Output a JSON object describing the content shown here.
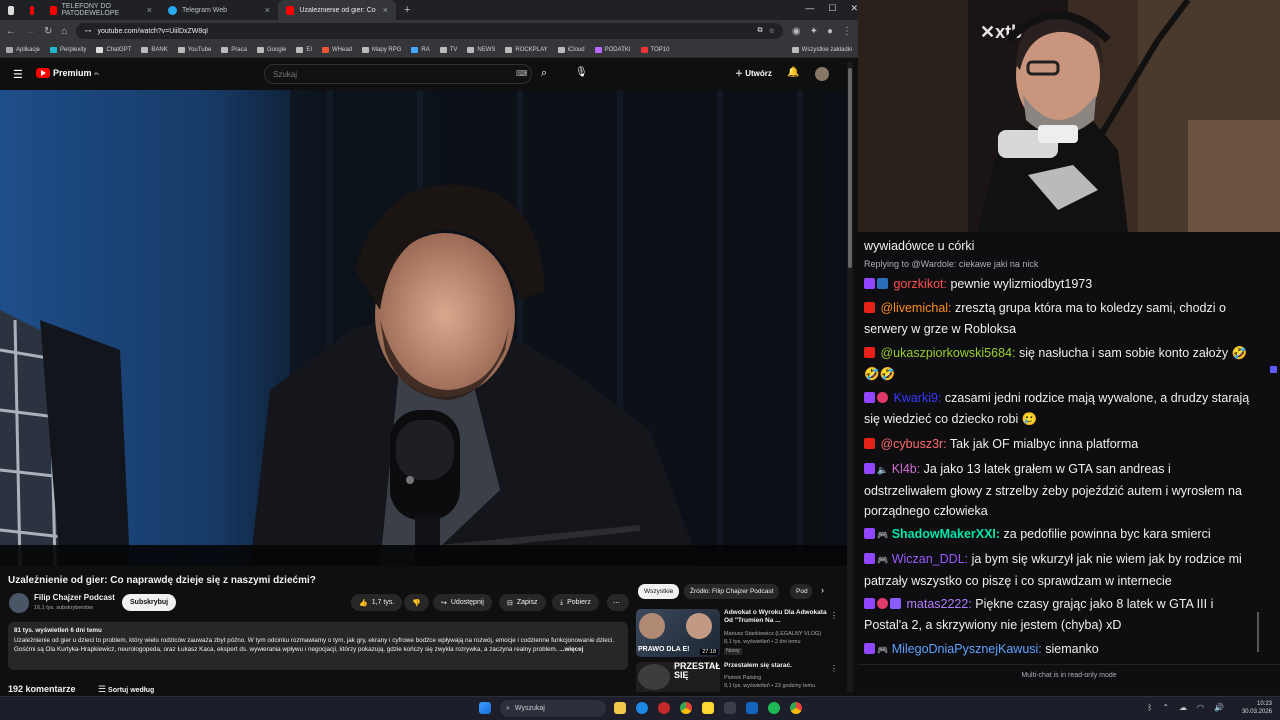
{
  "browser": {
    "tabs": [
      {
        "label": ""
      },
      {
        "label": "TELEFONY DO PATODEWELOPE"
      },
      {
        "label": "Telegram Web"
      },
      {
        "label": "Uzależnienie od gier: Co naprawdę"
      }
    ],
    "url": "youtube.com/watch?v=UiilDxZW8qI",
    "bookmarks": [
      "Aplikacje",
      "Perplexity",
      "ChatGPT",
      "BANK",
      "YouTube",
      "Praca",
      "Google",
      "EI",
      "WHead",
      "Mapy RPG",
      "RA",
      "TV",
      "NEWS",
      "ROCKPLAY",
      "iCloud",
      "PODATKI",
      "TOP10"
    ],
    "bookmarks_all": "Wszystkie zakładki"
  },
  "youtube": {
    "logo": "Premium",
    "logo_sup": "PL",
    "search_placeholder": "Szukaj",
    "create_label": "Utwórz",
    "video_title": "Uzależnienie od gier: Co naprawdę dzieje się z naszymi dziećmi?",
    "channel_name": "Filip Chajzer Podcast",
    "channel_subs": "16,1 tys. subskrybentów",
    "subscribe_label": "Subskrybuj",
    "likes": "1,7 tys.",
    "share_label": "Udostępnij",
    "save_label": "Zapisz",
    "download_label": "Pobierz",
    "desc_stats": "81 tys. wyświetleń  6 dni temu",
    "desc_text": "Uzależnienie od gier u dzieci to problem, który wielu rodziców zauważa zbyt późno. W tym odcinku rozmawiamy o tym, jak gry, ekrany i cyfrowe bodźce wpływają na rozwój, emocje i codzienne funkcjonowanie dzieci. Gośćmi są Ola Kurtyka-Hrapkiewicz, neurologopeda, oraz Łukasz Kaca, ekspert ds. wywierania wpływu i negocjacji, którzy pokazują, gdzie kończy się zwykła rozrywka, a zaczyna realny problem.",
    "desc_more": "...więcej",
    "comments_count": "192 komentarze",
    "sort_label": "Sortuj według",
    "chips": [
      "Wszystkie",
      "Źródło: Filip Chajzer Podcast",
      "Pod"
    ],
    "recommendations": [
      {
        "title": "Adwokat o Wyroku Dla Adwokata Od \"Trumien Na ...",
        "channel": "Mariusz Stankiewicz (LEGALNY VLOG)",
        "stats": "8,1 tys. wyświetleń • 2 dni temu",
        "badge": "Nowy",
        "thumb_text": "PRAWO DLA E!",
        "duration": "27:18"
      },
      {
        "title": "Przestałem się starać.",
        "channel": "Piotrek Parking",
        "stats": "9,1 tys. wyświetleń • 23 godziny temu",
        "badge": "",
        "thumb_text": "PRZESTAŁEM SIĘ",
        "duration": ""
      }
    ]
  },
  "chat": {
    "top_partial": "wywiadówce u córki",
    "reply": "Replying to @Wardole: ciekawe jaki na nick",
    "messages": [
      {
        "platform": "twitch",
        "user": "gorzkikot:",
        "color": "#ff4d4d",
        "text": " pewnie wylizmiodbyt1973"
      },
      {
        "platform": "youtube",
        "user": "@livemichal:",
        "color": "#ff8c1a",
        "text": " zresztą grupa która ma to koledzy sami, chodzi o serwery w grze w Robloksa"
      },
      {
        "platform": "youtube",
        "user": "@ukaszpiorkowski5684:",
        "color": "#9acd32",
        "text": " się nasłucha i sam sobie konto założy 🤣🤣🤣"
      },
      {
        "platform": "twitch",
        "user": "Kwarki9:",
        "color": "#3a3aff",
        "text": " czasami jedni rodzice mają wywalone, a drudzy starają się wiedzieć co dziecko robi 🥲"
      },
      {
        "platform": "youtube",
        "user": "@cybusz3r:",
        "color": "#ff6b6b",
        "text": " Tak jak OF mialbyc inna platforma"
      },
      {
        "platform": "twitch",
        "user": "Kl4b:",
        "color": "#d26cd2",
        "text": " Ja jako 13 latek grałem w GTA san andreas i odstrzeliwałem głowy z strzelby żeby pojeździć autem i wyrosłem na porządnego człowieka"
      },
      {
        "platform": "twitch",
        "user": "ShadowMakerXXI:",
        "color": "#00e5a8",
        "text": " za pedofilie powinna byc kara smierci"
      },
      {
        "platform": "twitch",
        "user": "Wiczan_DDL:",
        "color": "#9a5cff",
        "text": " ja bym się wkurzył jak nie wiem jak by rodzice mi patrzały wszystko co piszę i co sprawdzam w internecie"
      },
      {
        "platform": "twitch",
        "user": "matas2222:",
        "color": "#b07cff",
        "text": " Piękne czasy grając jako 8 latek w GTA III i Postal'a 2, a skrzywiony nie jestem (chyba) xD"
      },
      {
        "platform": "twitch",
        "user": "MilegoDniaPysznejKawusi:",
        "color": "#5ea2ff",
        "text": " siemanko"
      }
    ],
    "read_only": "Multi-chat is in read-only mode"
  },
  "taskbar": {
    "search_placeholder": "Wyszukaj",
    "time": "10:23",
    "date": "30.03.2026"
  },
  "colors": {
    "yt_red": "#ff0000",
    "twitch_purple": "#9146ff",
    "chat_bg": "#0e0e10"
  }
}
